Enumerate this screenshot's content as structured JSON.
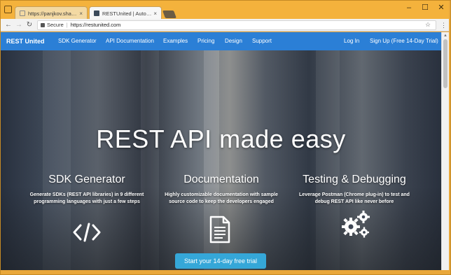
{
  "browser": {
    "tabs": [
      {
        "title": "https://panjkov.sharepoi",
        "close": "×"
      },
      {
        "title": "RESTUnited | Automated",
        "close": "×"
      }
    ],
    "window_controls": {
      "minimize": "–",
      "maximize": "☐",
      "close": "✕"
    },
    "address": {
      "secure_label": "Secure",
      "separator": "|",
      "url": "https://restunited.com"
    },
    "star": "☆",
    "menu": "⋮",
    "nav_glyphs": {
      "back": "←",
      "forward": "→",
      "reload": "↻"
    }
  },
  "site": {
    "brand": "REST United",
    "nav_items": [
      "SDK Generator",
      "API Documentation",
      "Examples",
      "Pricing",
      "Design",
      "Support"
    ],
    "login": "Log In",
    "signup": "Sign Up (Free 14-Day Trial)",
    "hero_title": "REST API made easy",
    "features": [
      {
        "title": "SDK Generator",
        "text": "Generate SDKs (REST API libraries) in 9 different programming languages with just a few steps",
        "icon": "code-icon"
      },
      {
        "title": "Documentation",
        "text": "Highly customizable documentation with sample source code to keep the developers engaged",
        "icon": "document-icon"
      },
      {
        "title": "Testing & Debugging",
        "text": "Leverage Postman (Chrome plug-in) to test and debug REST API like never before",
        "icon": "gears-icon"
      }
    ],
    "cta": "Start your 14-day free trial",
    "colors": {
      "nav_bg": "#2b7fd6",
      "cta_bg": "#35a7d8",
      "frame": "#f4b23c"
    }
  }
}
